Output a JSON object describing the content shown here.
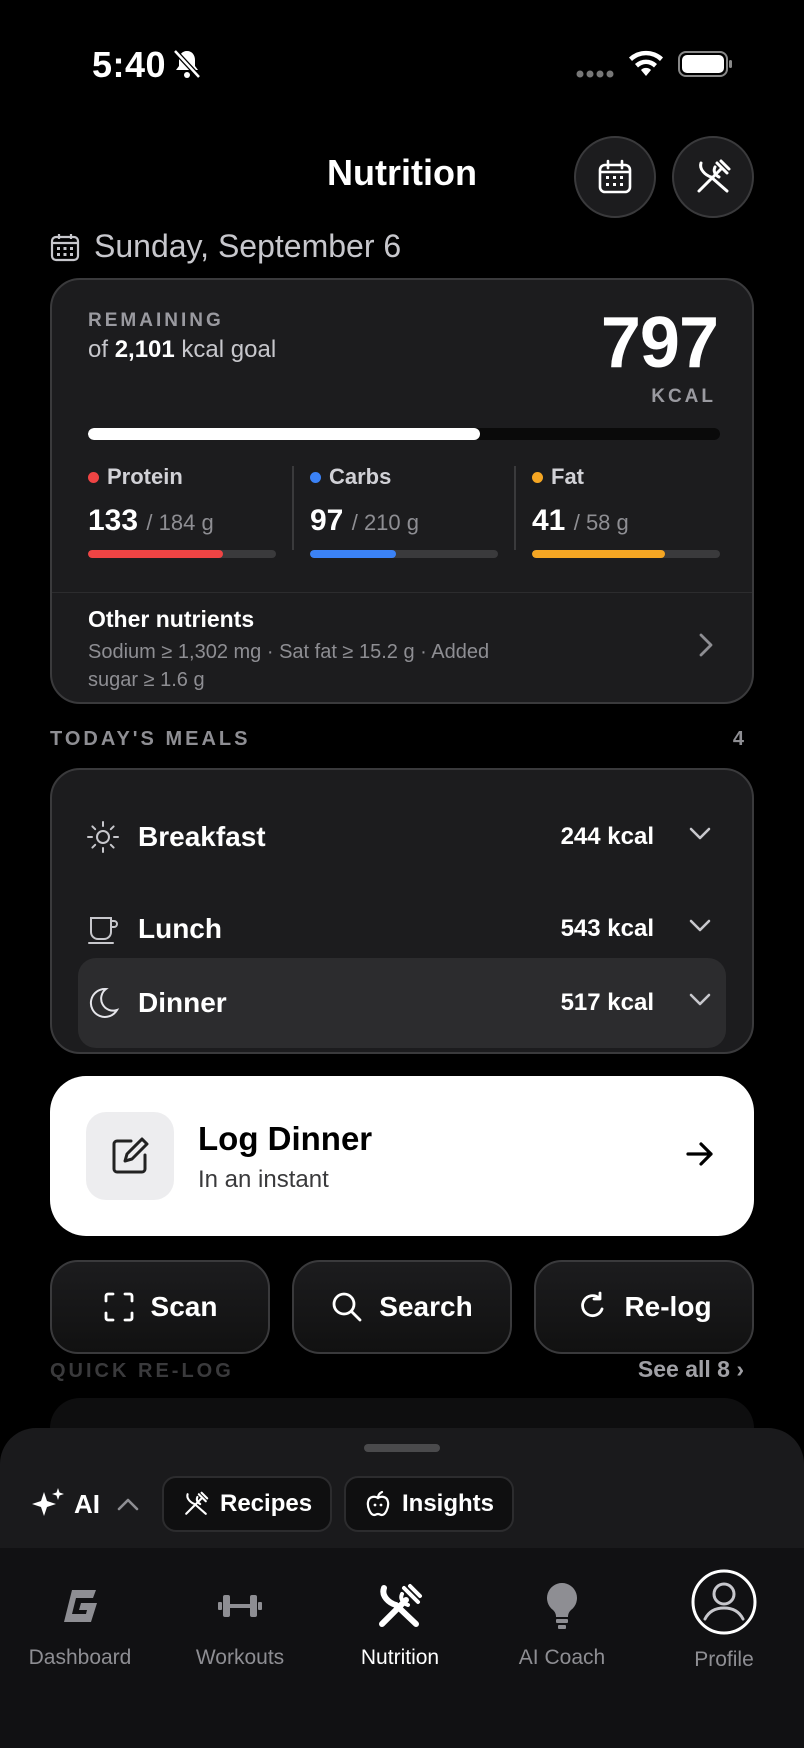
{
  "status_bar": {
    "time": "5:40"
  },
  "header": {
    "title": "Nutrition"
  },
  "date": "Sunday, September 6",
  "summary": {
    "remaining_label": "REMAINING",
    "goal_prefix": "of",
    "goal_value": "2,101",
    "goal_suffix": "kcal goal",
    "remaining_kcal": "797",
    "kcal_unit": "KCAL",
    "progress_fraction": 0.62,
    "macros": [
      {
        "name": "Protein",
        "value": "133",
        "goal": "/ 184 g",
        "color": "#ef4444",
        "fraction": 0.72
      },
      {
        "name": "Carbs",
        "value": "97",
        "goal": "/ 210 g",
        "color": "#3b82f6",
        "fraction": 0.46
      },
      {
        "name": "Fat",
        "value": "41",
        "goal": "/ 58 g",
        "color": "#f5a623",
        "fraction": 0.71
      }
    ],
    "other_title": "Other nutrients",
    "other_detail": "Sodium ≥ 1,302 mg · Sat fat ≥ 15.2 g · Added sugar ≥ 1.6 g"
  },
  "meals": {
    "section_label": "TODAY'S MEALS",
    "count": "4",
    "items": [
      {
        "name": "Breakfast",
        "kcal": "244 kcal",
        "icon": "sun-icon"
      },
      {
        "name": "Lunch",
        "kcal": "543 kcal",
        "icon": "cup-icon"
      },
      {
        "name": "Dinner",
        "kcal": "517 kcal",
        "icon": "moon-icon"
      }
    ]
  },
  "log_card": {
    "title": "Log Dinner",
    "subtitle": "In an instant",
    "icon": "edit-icon"
  },
  "quick_actions": [
    {
      "label": "Scan",
      "icon": "scan-icon"
    },
    {
      "label": "Search",
      "icon": "search-icon"
    },
    {
      "label": "Re-log",
      "icon": "refresh-icon"
    }
  ],
  "quick_relog": {
    "label": "QUICK RE-LOG",
    "see_all": "See all 8 ›"
  },
  "sheet": {
    "ai_label": "AI",
    "chips": [
      {
        "label": "Recipes",
        "icon": "utensils-icon"
      },
      {
        "label": "Insights",
        "icon": "apple-icon"
      }
    ]
  },
  "tabs": [
    {
      "label": "Dashboard",
      "icon": "logo-g-icon",
      "active": false
    },
    {
      "label": "Workouts",
      "icon": "dumbbell-icon",
      "active": false
    },
    {
      "label": "Nutrition",
      "icon": "utensils-icon",
      "active": true
    },
    {
      "label": "AI Coach",
      "icon": "lightbulb-icon",
      "active": false
    },
    {
      "label": "Profile",
      "icon": "profile-icon",
      "active": false
    }
  ]
}
